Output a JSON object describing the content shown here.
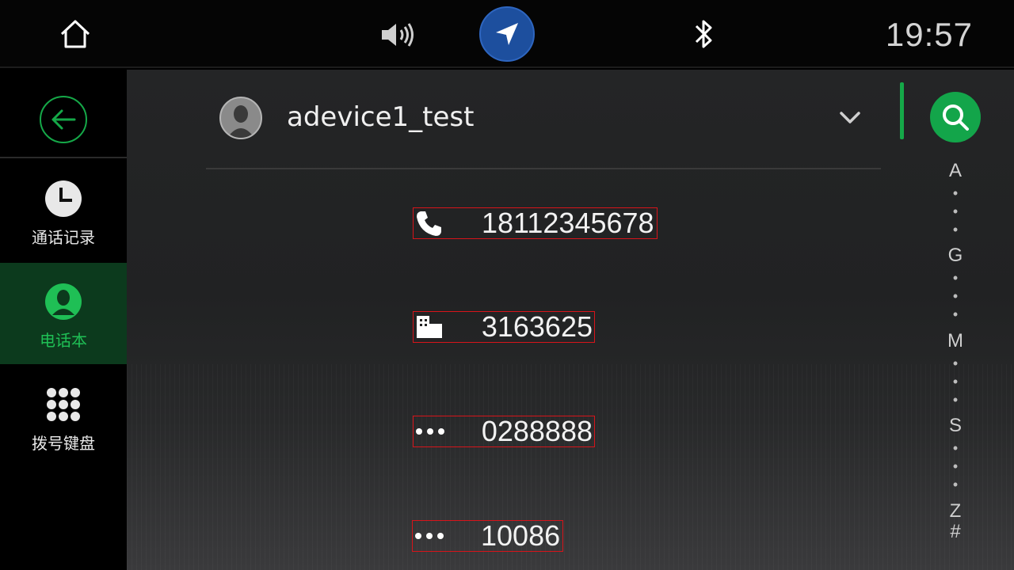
{
  "status_bar": {
    "time": "19:57",
    "icons": [
      "home-icon",
      "volume-icon",
      "navigation-icon",
      "bluetooth-icon"
    ],
    "nav_accent": "#1d4f9e"
  },
  "sidebar": {
    "accent": "#15a848",
    "items": [
      {
        "label": "通话记录",
        "icon": "clock-icon",
        "selected": false
      },
      {
        "label": "电话本",
        "icon": "contact-icon",
        "selected": true
      },
      {
        "label": "拨号键盘",
        "icon": "dialpad-icon",
        "selected": false
      }
    ]
  },
  "contact": {
    "name": "adevice1_test",
    "numbers": [
      {
        "type_icon": "mobile-phone-icon",
        "number": "18112345678"
      },
      {
        "type_icon": "office-building-icon",
        "number": "3163625"
      },
      {
        "type_icon": "other-dots-icon",
        "number": "0288888"
      },
      {
        "type_icon": "other-dots-icon",
        "number": "10086"
      }
    ]
  },
  "alpha_index": [
    "A",
    "•",
    "•",
    "•",
    "G",
    "•",
    "•",
    "•",
    "M",
    "•",
    "•",
    "•",
    "S",
    "•",
    "•",
    "•",
    "Z",
    "#"
  ]
}
